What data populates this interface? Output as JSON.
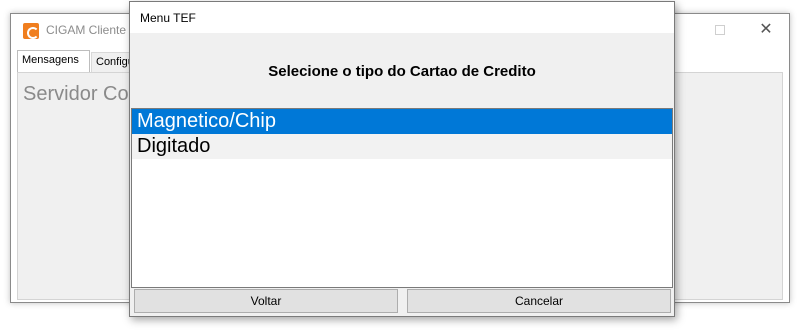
{
  "background_window": {
    "title": "CIGAM Cliente",
    "app_icon": "cigam-logo-icon",
    "tabs": [
      "Mensagens",
      "Configu"
    ],
    "server_label": "Servidor Co"
  },
  "dialog": {
    "title": "Menu TEF",
    "prompt": "Selecione o tipo do Cartao de Credito",
    "options": [
      "Magnetico/Chip",
      "Digitado"
    ],
    "selected_index": 0,
    "buttons": {
      "back_label": "Voltar",
      "cancel_label": "Cancelar"
    }
  },
  "colors": {
    "selection": "#0078d7",
    "brand_icon": "#f07e1e"
  }
}
